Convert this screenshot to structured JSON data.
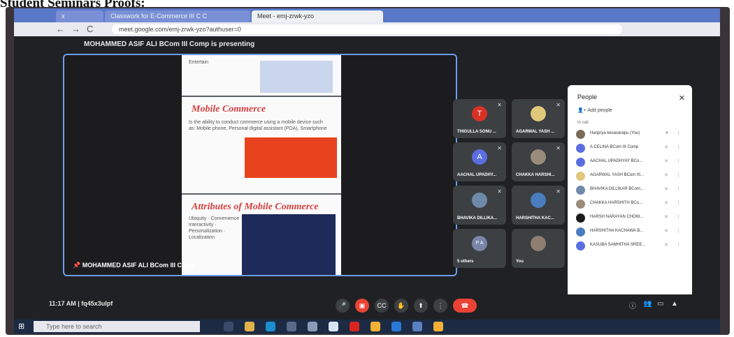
{
  "caption": "Student Seminars Proofs:",
  "browser": {
    "tabs": [
      {
        "label": "x"
      },
      {
        "label": "Classwork for E-Commerce III C C"
      },
      {
        "label": "Meet - emj-zrwk-yzo"
      }
    ],
    "url": "meet.google.com/emj-zrwk-yzo?authuser=0"
  },
  "meet": {
    "presenting_text": "MOHAMMED ASIF ALI BCom III Comp is presenting",
    "stage_name": "MOHAMMED ASIF ALI BCom III Comp",
    "slides": [
      {
        "title": "",
        "text": "Entertain"
      },
      {
        "title": "Mobile Commerce",
        "text": "Is the ability to conduct commerce using a mobile device such as: Mobile phone, Personal digital assistant (PDA), Smartphone"
      },
      {
        "title": "Attributes of Mobile Commerce",
        "text": "Ubiquity · Convenience · Interactivity · Personalization · Localization"
      }
    ],
    "tiles": [
      {
        "name": "THIGULLA SONU ...",
        "initial": "T",
        "color": "#d93025"
      },
      {
        "name": "AGARWAL YASH ...",
        "initial": "",
        "color": "#e0c77a"
      },
      {
        "name": "AACHAL UPADHY...",
        "initial": "A",
        "color": "#5b6ee1"
      },
      {
        "name": "CHAKKA HARSHI...",
        "initial": "",
        "color": "#9a8c7a"
      },
      {
        "name": "BHAVIKA DILLIKA...",
        "initial": "",
        "color": "#6f8aa8"
      },
      {
        "name": "HARSHITHA KAC...",
        "initial": "",
        "color": "#4a7cc0"
      },
      {
        "name": "5 others",
        "initial": "P A",
        "color": "#7b85a8"
      },
      {
        "name": "You",
        "initial": "",
        "color": "#8e7f70"
      }
    ],
    "time": "11:17 AM",
    "meeting_code": "fq45x3ulpf"
  },
  "people": {
    "title": "People",
    "add_people": "Add people",
    "in_call": "In call",
    "list": [
      {
        "name": "Hariprya kesavarapu (You)",
        "color": "#7a6a5a"
      },
      {
        "name": "A CELINA BCom III Comp",
        "color": "#5b6ee1"
      },
      {
        "name": "AACHAL UPADHYAY BCo...",
        "color": "#5b6ee1"
      },
      {
        "name": "AGARWAL YASH BCom III...",
        "color": "#e0c77a"
      },
      {
        "name": "BHAVIKA DILLIKAR BCom...",
        "color": "#6f8aa8"
      },
      {
        "name": "CHAKKA HARSHITH BCo...",
        "color": "#9a8c7a"
      },
      {
        "name": "HARSH NARAYAN CHOW...",
        "color": "#1a1a1a"
      },
      {
        "name": "HARSHITHA KACHAWA B...",
        "color": "#4a7cc0"
      },
      {
        "name": "KASUBA SAMHITHA SREE...",
        "color": "#5b6ee1"
      }
    ]
  },
  "taskbar": {
    "search_placeholder": "Type here to search"
  }
}
